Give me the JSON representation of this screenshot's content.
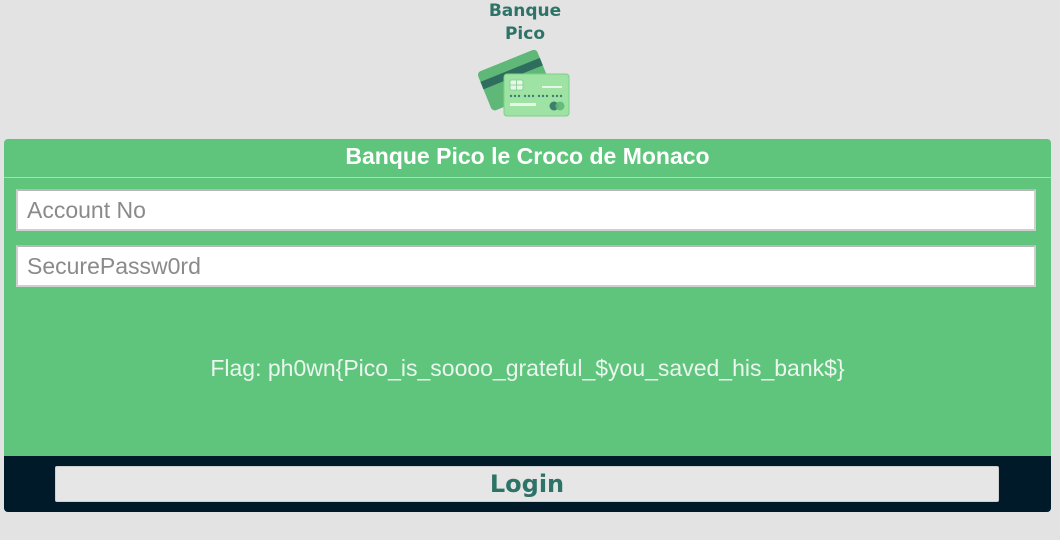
{
  "brand": {
    "name_line1": "Banque",
    "name_line2": "Pico",
    "logo_icon": "credit-cards-icon",
    "colors": {
      "brand_text": "#2e7368",
      "card_green": "#5fc57c",
      "footer_dark": "#011a2a"
    }
  },
  "login_panel": {
    "title": "Banque Pico le Croco de Monaco",
    "account_placeholder": "Account No",
    "password_placeholder": "SecurePassw0rd",
    "flag_text": "Flag: ph0wn{Pico_is_soooo_grateful_$you_saved_his_bank$}",
    "login_label": "Login"
  }
}
